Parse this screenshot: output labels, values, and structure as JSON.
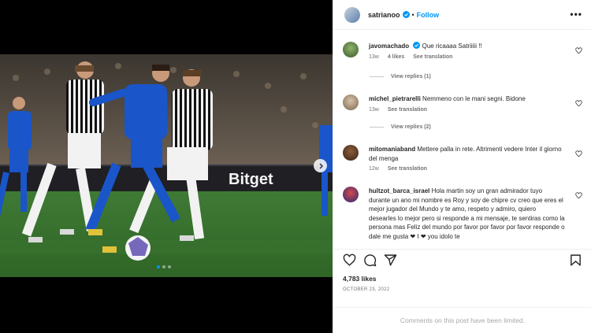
{
  "post": {
    "username": "satrianoo",
    "follow_label": "Follow",
    "separator": "•",
    "more_label": "•••",
    "likes": "4,783 likes",
    "date": "OCTOBER 23, 2022",
    "comments_limited": "Comments on this post have been limited.",
    "banner_text": "Bitget",
    "carousel": {
      "count": 3,
      "active": 1
    }
  },
  "comments": [
    {
      "username": "javomachado",
      "verified": true,
      "text": "Que ricaaaa Satriiiii !!",
      "time": "13w",
      "likes": "4 likes",
      "translate": "See translation",
      "view_replies": "View replies (1)"
    },
    {
      "username": "michel_pietrarelli",
      "verified": false,
      "text": "Nemmeno con le mani segni. Bidone",
      "time": "13w",
      "translate": "See translation",
      "view_replies": "View replies (2)"
    },
    {
      "username": "mitomaniaband",
      "verified": false,
      "text": "Mettere palla in rete. Altrimenti vedere Inter il giorno del menga",
      "time": "12w",
      "translate": "See translation"
    },
    {
      "username": "hultzot_barca_israel",
      "verified": false,
      "text": "Hola martin soy un gran admirador tuyo durante un ano mi nombre es Roy y soy de chipre cv creo que eres el mejor jugador del Mundo y te amo, respeto y admiro, quiero desearles lo mejor pero si responde a mi mensaje, te sentiras como la persona mas Feliz del mundo por favor por favor por favor responde o dale me gusta ❤ I ❤ you idolo te"
    }
  ],
  "colors": {
    "accent": "#0095f6",
    "text": "#262626",
    "muted": "#737373",
    "border": "#efefef",
    "empoli_blue": "#1a55c9",
    "juve_stripe": "#111111"
  },
  "icons": [
    "verified-badge-icon",
    "more-options-icon",
    "heart-icon",
    "comment-icon",
    "share-icon",
    "save-icon",
    "next-arrow-icon"
  ]
}
